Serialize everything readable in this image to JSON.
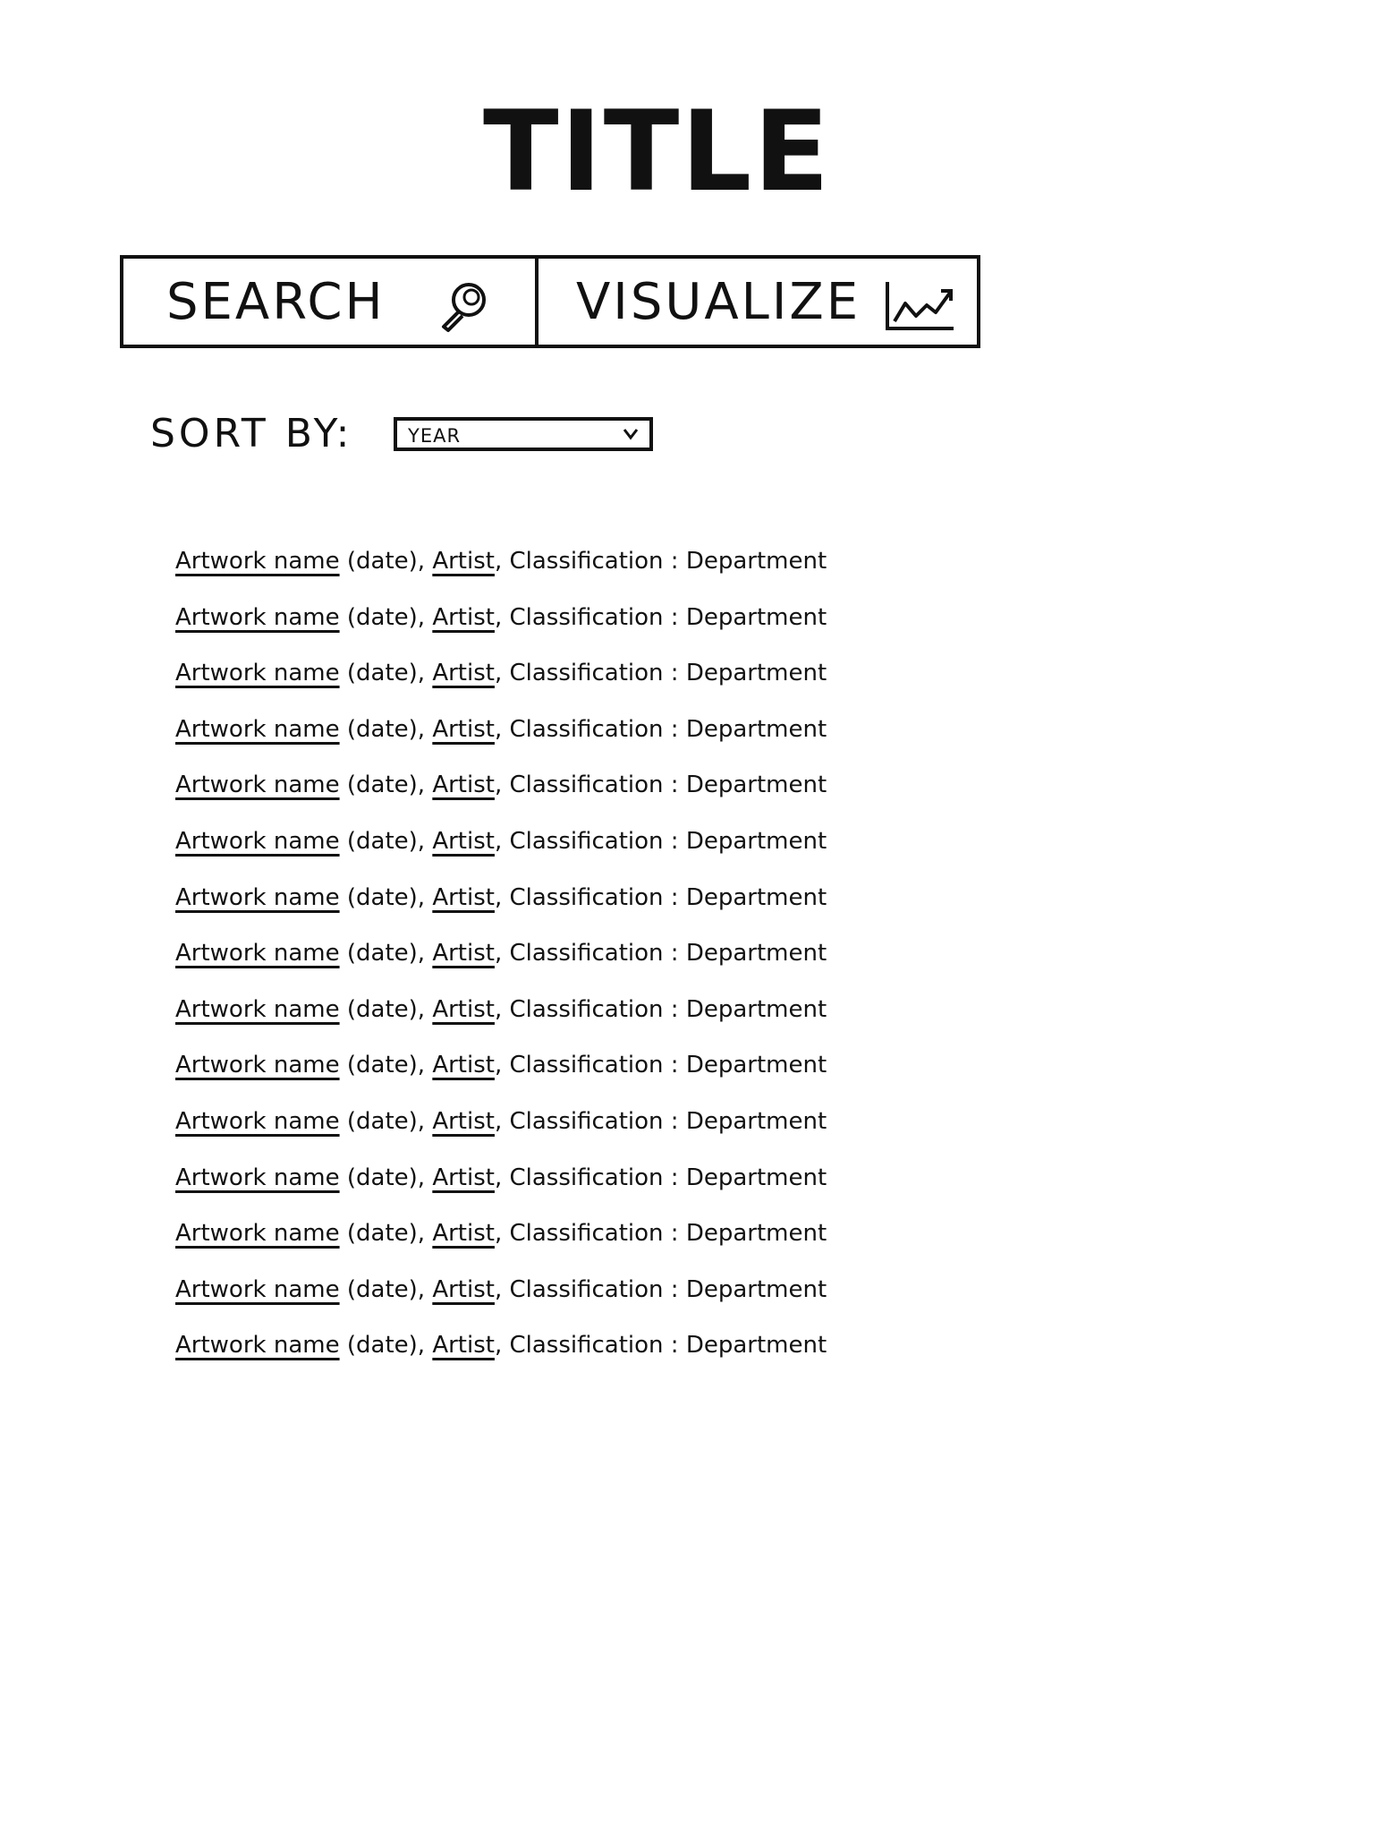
{
  "page": {
    "title": "TITLE"
  },
  "tabs": [
    {
      "label": "SEARCH",
      "icon": "search-icon"
    },
    {
      "label": "VISUALIZE",
      "icon": "line-chart-icon"
    }
  ],
  "sort": {
    "label": "SORT BY:",
    "selected": "YEAR"
  },
  "results": [
    {
      "name": "Artwork name",
      "date": "(date)",
      "artist": "Artist",
      "classification": "Classification",
      "department": "Department"
    },
    {
      "name": "Artwork name",
      "date": "(date)",
      "artist": "Artist",
      "classification": "Classification",
      "department": "Department"
    },
    {
      "name": "Artwork name",
      "date": "(date)",
      "artist": "Artist",
      "classification": "Classification",
      "department": "Department"
    },
    {
      "name": "Artwork name",
      "date": "(date)",
      "artist": "Artist",
      "classification": "Classification",
      "department": "Department"
    },
    {
      "name": "Artwork name",
      "date": "(date)",
      "artist": "Artist",
      "classification": "Classification",
      "department": "Department"
    },
    {
      "name": "Artwork name",
      "date": "(date)",
      "artist": "Artist",
      "classification": "Classification",
      "department": "Department"
    },
    {
      "name": "Artwork name",
      "date": "(date)",
      "artist": "Artist",
      "classification": "Classification",
      "department": "Department"
    },
    {
      "name": "Artwork name",
      "date": "(date)",
      "artist": "Artist",
      "classification": "Classification",
      "department": "Department"
    },
    {
      "name": "Artwork name",
      "date": "(date)",
      "artist": "Artist",
      "classification": "Classification",
      "department": "Department"
    },
    {
      "name": "Artwork name",
      "date": "(date)",
      "artist": "Artist",
      "classification": "Classification",
      "department": "Department"
    },
    {
      "name": "Artwork name",
      "date": "(date)",
      "artist": "Artist",
      "classification": "Classification",
      "department": "Department"
    },
    {
      "name": "Artwork name",
      "date": "(date)",
      "artist": "Artist",
      "classification": "Classification",
      "department": "Department"
    },
    {
      "name": "Artwork name",
      "date": "(date)",
      "artist": "Artist",
      "classification": "Classification",
      "department": "Department"
    },
    {
      "name": "Artwork name",
      "date": "(date)",
      "artist": "Artist",
      "classification": "Classification",
      "department": "Department"
    },
    {
      "name": "Artwork name",
      "date": "(date)",
      "artist": "Artist",
      "classification": "Classification",
      "department": "Department"
    }
  ]
}
